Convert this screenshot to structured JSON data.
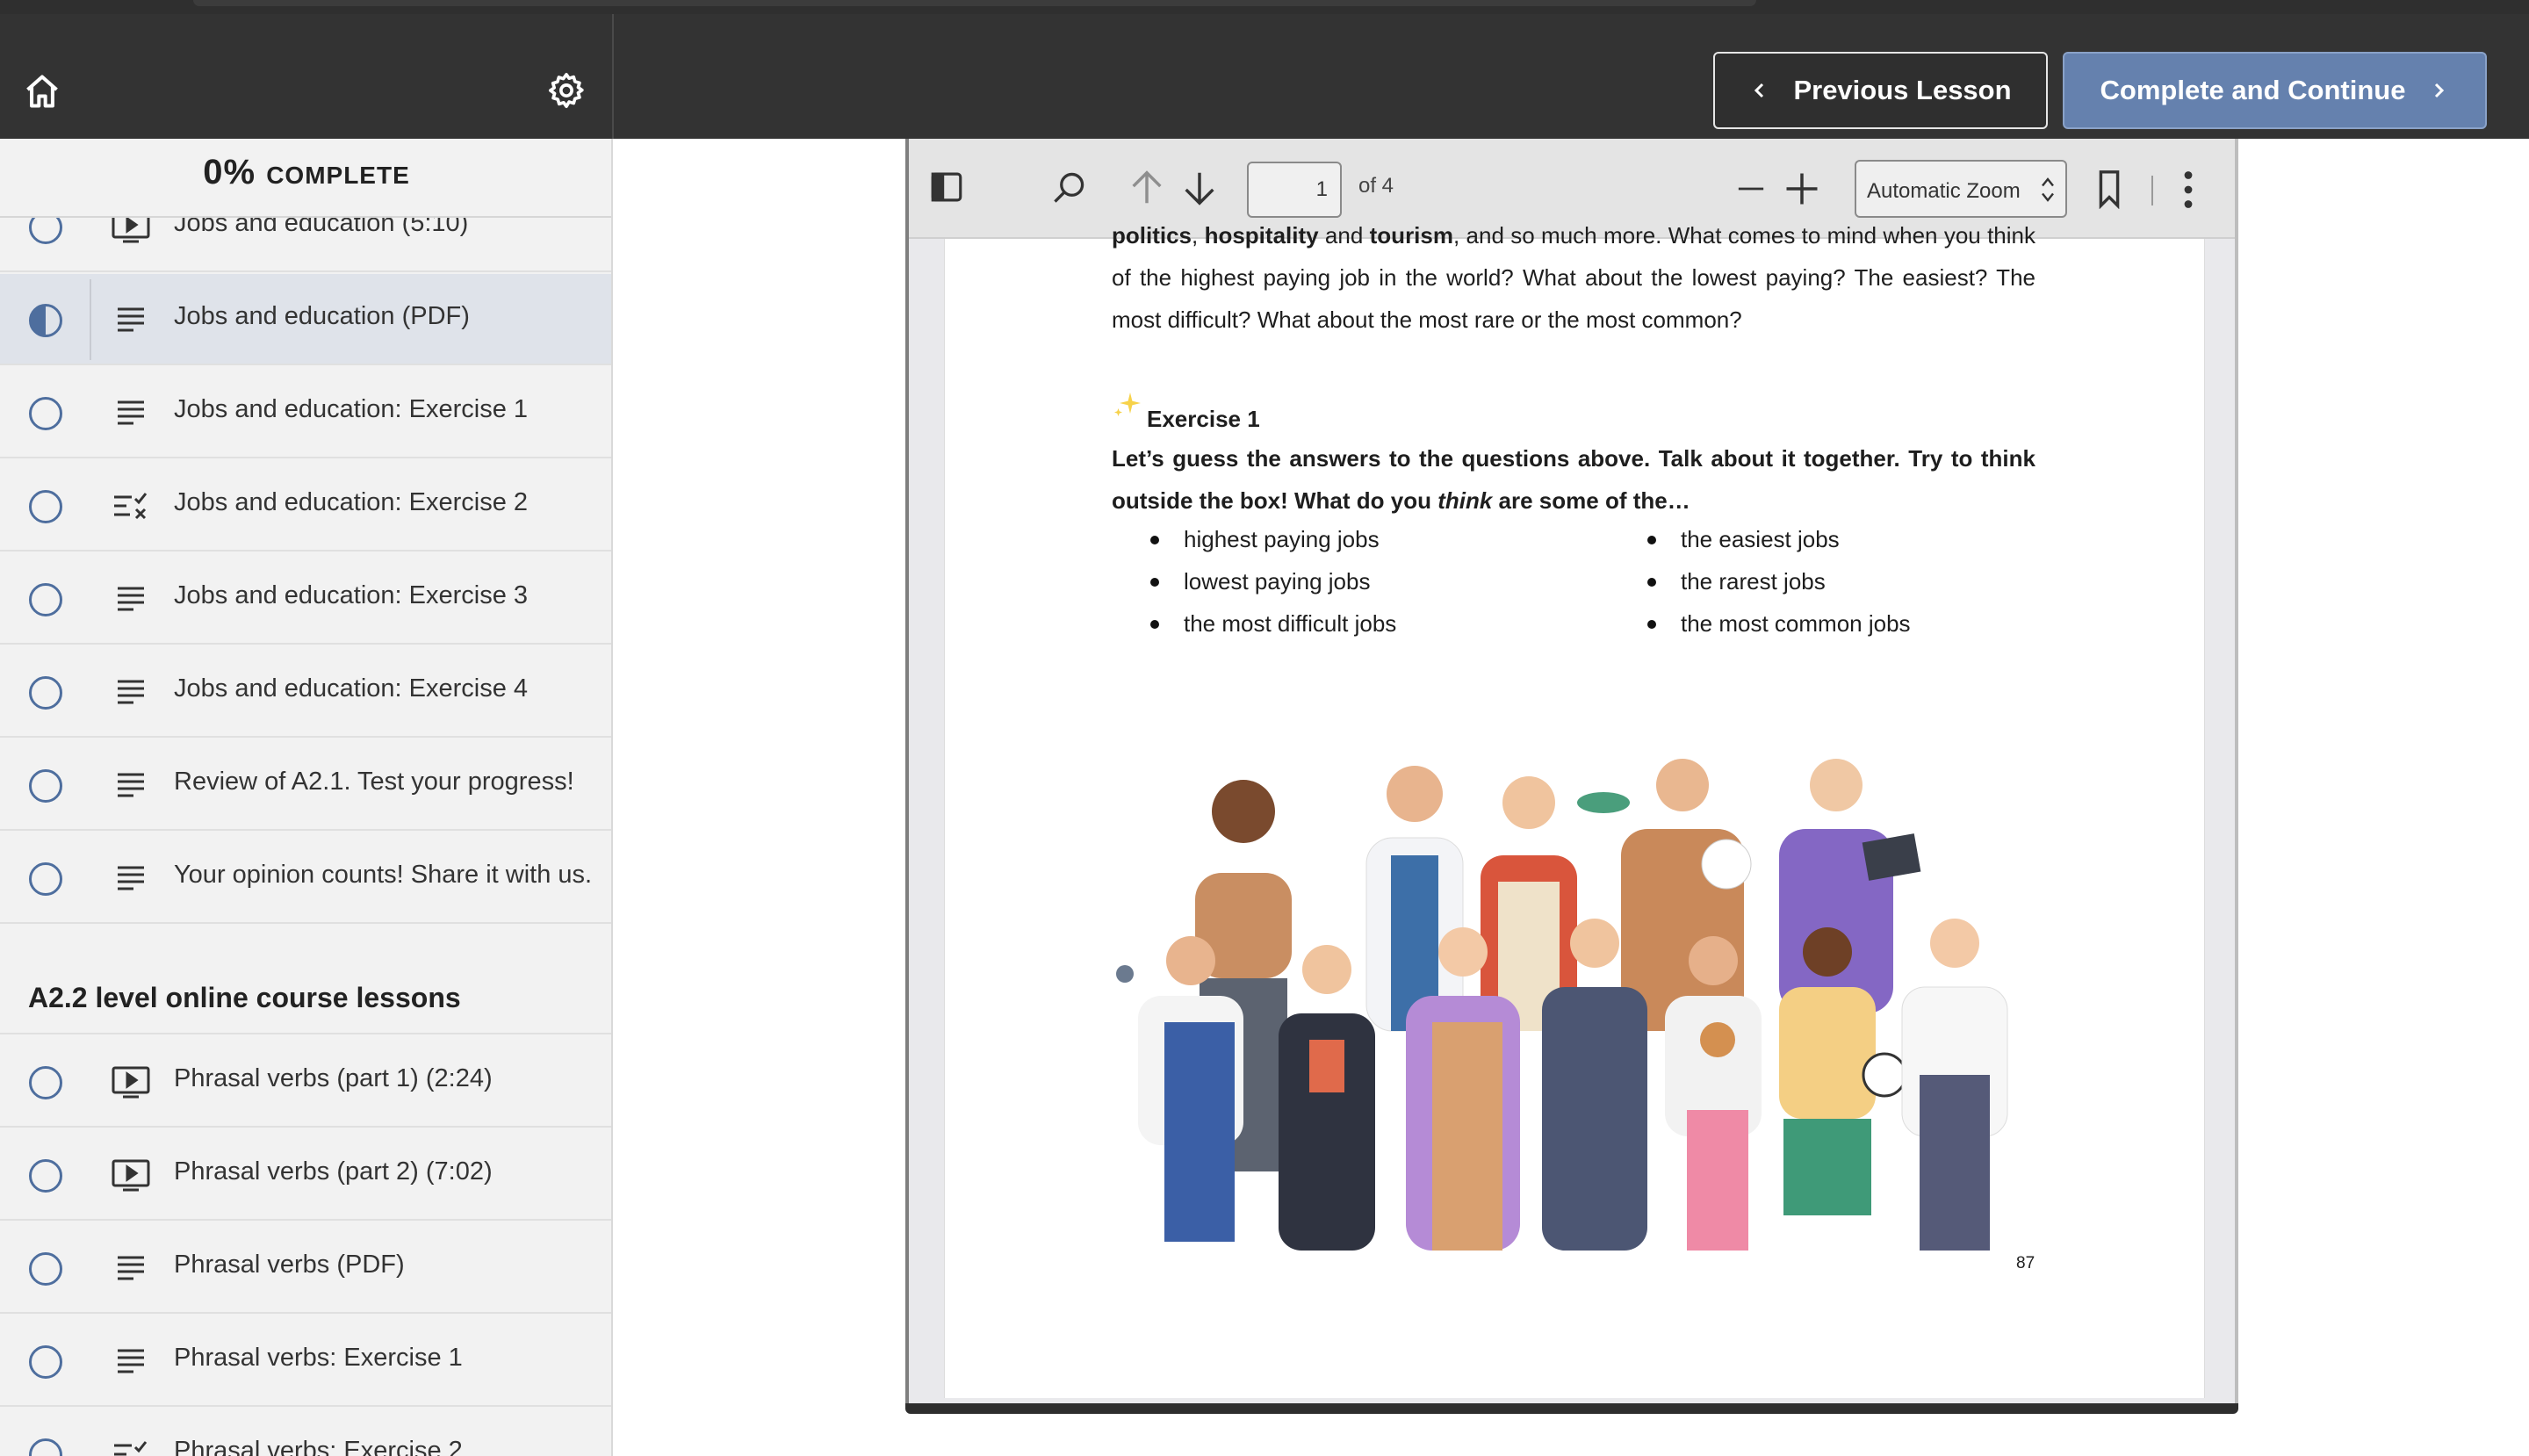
{
  "header": {
    "prev_label": "Previous Lesson",
    "next_label": "Complete and Continue"
  },
  "sidebar": {
    "progress_pct": "0%",
    "progress_label": "COMPLETE",
    "items": [
      {
        "label": "Jobs and education (5:10)",
        "icon": "video-icon"
      },
      {
        "label": "Jobs and education (PDF)",
        "icon": "text-lines-icon",
        "state": "in-progress"
      },
      {
        "label": "Jobs and education: Exercise 1",
        "icon": "text-lines-icon"
      },
      {
        "label": "Jobs and education: Exercise 2",
        "icon": "quiz-icon"
      },
      {
        "label": "Jobs and education: Exercise 3",
        "icon": "text-lines-icon"
      },
      {
        "label": "Jobs and education: Exercise 4",
        "icon": "text-lines-icon"
      },
      {
        "label": "Review of A2.1. Test your progress!",
        "icon": "text-lines-icon"
      },
      {
        "label": "Your opinion counts! Share it with us.",
        "icon": "text-lines-icon"
      }
    ],
    "section_title": "A2.2 level online course lessons",
    "items2": [
      {
        "label": "Phrasal verbs (part 1) (2:24)",
        "icon": "video-icon"
      },
      {
        "label": "Phrasal verbs (part 2) (7:02)",
        "icon": "video-icon"
      },
      {
        "label": "Phrasal verbs (PDF)",
        "icon": "text-lines-icon"
      },
      {
        "label": "Phrasal verbs: Exercise 1",
        "icon": "text-lines-icon"
      },
      {
        "label": "Phrasal verbs: Exercise 2",
        "icon": "quiz-icon"
      }
    ]
  },
  "viewer": {
    "page_number": "1",
    "of_pages": "of 4",
    "zoom": "Automatic Zoom"
  },
  "document": {
    "intro_bold1": "politics",
    "intro_sep1": ", ",
    "intro_bold2": "hospitality",
    "intro_and": " and ",
    "intro_bold3": "tourism",
    "intro_rest": ", and so much more.  What comes to mind when you think of the highest paying job in the world?  What about the lowest paying?  The easiest?  The most difficult?  What about the most rare or the most common?",
    "exercise_title": "Exercise 1",
    "instruction_part1": "Let’s guess the answers to the questions above.  Talk about it together.  Try to think outside the box!  What do you ",
    "instruction_italic": "think",
    "instruction_part2": " are some of the…",
    "bullets_left": [
      "highest paying jobs",
      "lowest paying jobs",
      "the most difficult jobs"
    ],
    "bullets_right": [
      "the easiest jobs",
      "the rarest jobs",
      "the most common jobs"
    ],
    "page_number": "87"
  }
}
